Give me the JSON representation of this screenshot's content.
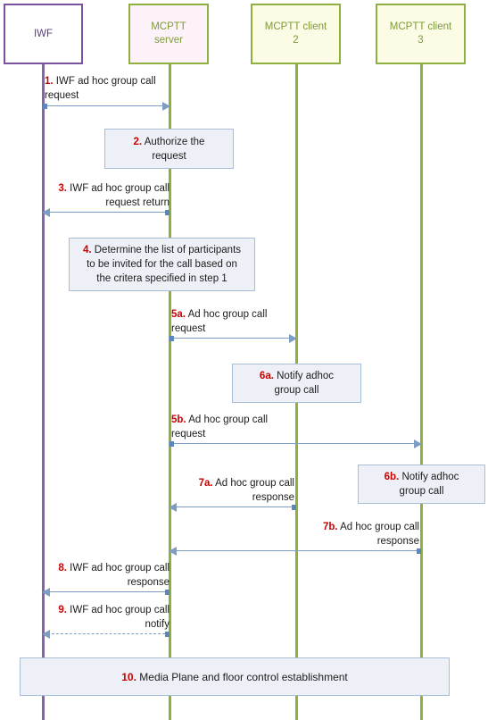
{
  "diagram": {
    "title": "IWF ad hoc group call sequence",
    "colors": {
      "lifeline_green": "#8FB03E",
      "lifeline_purple": "#8464A8",
      "arrow_blue": "#7D9DC4",
      "step_number_red": "#CC0000",
      "note_fill": "#EDF1F7",
      "note_border": "#A8BDD6",
      "server_fill": "#FDF2FA",
      "client_fill": "#FBFBE6",
      "iwf_border": "#7B52A0"
    }
  },
  "actors": [
    {
      "id": "iwf",
      "label": "IWF"
    },
    {
      "id": "server",
      "label": "MCPTT\nserver"
    },
    {
      "id": "client2",
      "label": "MCPTT client\n2"
    },
    {
      "id": "client3",
      "label": "MCPTT client\n3"
    }
  ],
  "steps": [
    {
      "number": "1.",
      "text": "IWF ad hoc group call request",
      "kind": "message",
      "from": "iwf",
      "to": "server",
      "style": "solid",
      "align": "left"
    },
    {
      "number": "2.",
      "text": "Authorize the request",
      "kind": "note",
      "on": "server"
    },
    {
      "number": "3.",
      "text": "IWF ad hoc group call request return",
      "kind": "message",
      "from": "server",
      "to": "iwf",
      "style": "solid",
      "align": "right"
    },
    {
      "number": "4.",
      "text": "Determine the list of participants to be invited for the call based on the critera specified in step 1",
      "kind": "note",
      "on": "server"
    },
    {
      "number": "5a.",
      "text": "Ad hoc group call request",
      "kind": "message",
      "from": "server",
      "to": "client2",
      "style": "solid",
      "align": "left"
    },
    {
      "number": "6a.",
      "text": "Notify adhoc group call",
      "kind": "note",
      "on": "client2"
    },
    {
      "number": "5b.",
      "text": "Ad hoc group call request",
      "kind": "message",
      "from": "server",
      "to": "client3",
      "style": "solid",
      "align": "left"
    },
    {
      "number": "6b.",
      "text": "Notify adhoc group call",
      "kind": "note",
      "on": "client3"
    },
    {
      "number": "7a.",
      "text": "Ad hoc group call response",
      "kind": "message",
      "from": "client2",
      "to": "server",
      "style": "solid",
      "align": "right"
    },
    {
      "number": "7b.",
      "text": "Ad hoc group call response",
      "kind": "message",
      "from": "client3",
      "to": "server",
      "style": "solid",
      "align": "right"
    },
    {
      "number": "8.",
      "text": "IWF ad hoc group call response",
      "kind": "message",
      "from": "server",
      "to": "iwf",
      "style": "solid",
      "align": "right"
    },
    {
      "number": "9.",
      "text": "IWF ad hoc group call notify",
      "kind": "message",
      "from": "server",
      "to": "iwf",
      "style": "dashed",
      "align": "right"
    },
    {
      "number": "10.",
      "text": "Media Plane and floor control establishment",
      "kind": "note",
      "on": "all"
    }
  ],
  "labels": {
    "step1": {
      "num": "1.",
      "line1": "IWF ad hoc group call",
      "line2": "request"
    },
    "step2": {
      "num": "2.",
      "line1": "Authorize the",
      "line2": "request"
    },
    "step3": {
      "num": "3.",
      "line1": "IWF ad hoc group call",
      "line2": "request return"
    },
    "step4": {
      "num": "4.",
      "line1": "Determine the list of participants",
      "line2": "to be invited for the call based on",
      "line3": "the critera specified in step 1"
    },
    "step5a": {
      "num": "5a.",
      "line1": "Ad hoc group call",
      "line2": "request"
    },
    "step6a": {
      "num": "6a.",
      "line1": "Notify adhoc",
      "line2": "group call"
    },
    "step5b": {
      "num": "5b.",
      "line1": "Ad hoc group call",
      "line2": "request"
    },
    "step6b": {
      "num": "6b.",
      "line1": "Notify adhoc",
      "line2": "group call"
    },
    "step7a": {
      "num": "7a.",
      "line1": "Ad hoc group call",
      "line2": "response"
    },
    "step7b": {
      "num": "7b.",
      "line1": "Ad hoc group call",
      "line2": "response"
    },
    "step8": {
      "num": "8.",
      "line1": "IWF ad hoc group call",
      "line2": "response"
    },
    "step9": {
      "num": "9.",
      "line1": "IWF ad hoc group call",
      "line2": "notify"
    },
    "step10": {
      "num": "10.",
      "line1": "Media Plane and floor control establishment"
    }
  },
  "actor_labels": {
    "iwf": {
      "line1": "IWF",
      "line2": ""
    },
    "server": {
      "line1": "MCPTT",
      "line2": "server"
    },
    "client2": {
      "line1": "MCPTT client",
      "line2": "2"
    },
    "client3": {
      "line1": "MCPTT client",
      "line2": "3"
    }
  }
}
